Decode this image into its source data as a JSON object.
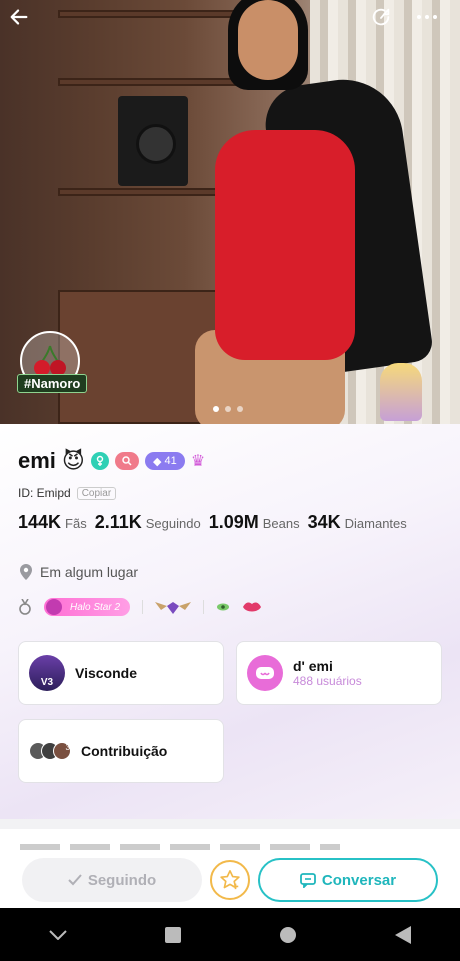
{
  "colors": {
    "accent_cyan": "#27c1c6",
    "star_gold": "#f2b94a",
    "pink": "#e86cd8",
    "purple_pill": "#8b7bf0",
    "level_pill": "#7c6cf0"
  },
  "hero": {
    "tag": "#Namoro",
    "icons": {
      "back": "back-arrow-icon",
      "share": "share-icon",
      "more": "more-dots-icon",
      "badge": "cherry-icon"
    }
  },
  "profile": {
    "name": "emi",
    "name_emoji": "😈",
    "level": "41",
    "id_label": "ID: Emipd",
    "copy_label": "Copiar",
    "stats": [
      {
        "value": "144K",
        "label": "Fãs"
      },
      {
        "value": "2.11K",
        "label": "Seguindo"
      },
      {
        "value": "1.09M",
        "label": "Beans"
      },
      {
        "value": "34K",
        "label": "Diamantes"
      }
    ],
    "location": "Em algum lugar",
    "halo_label": "Halo Star 2"
  },
  "cards": {
    "visconde": {
      "title": "Visconde",
      "badge": "V3"
    },
    "fanclub": {
      "title": "d' emi",
      "subtitle": "488 usuários"
    },
    "contribution": {
      "title": "Contribuição",
      "rank3": "3"
    }
  },
  "actions": {
    "follow_label": "Seguindo",
    "chat_label": "Conversar"
  }
}
